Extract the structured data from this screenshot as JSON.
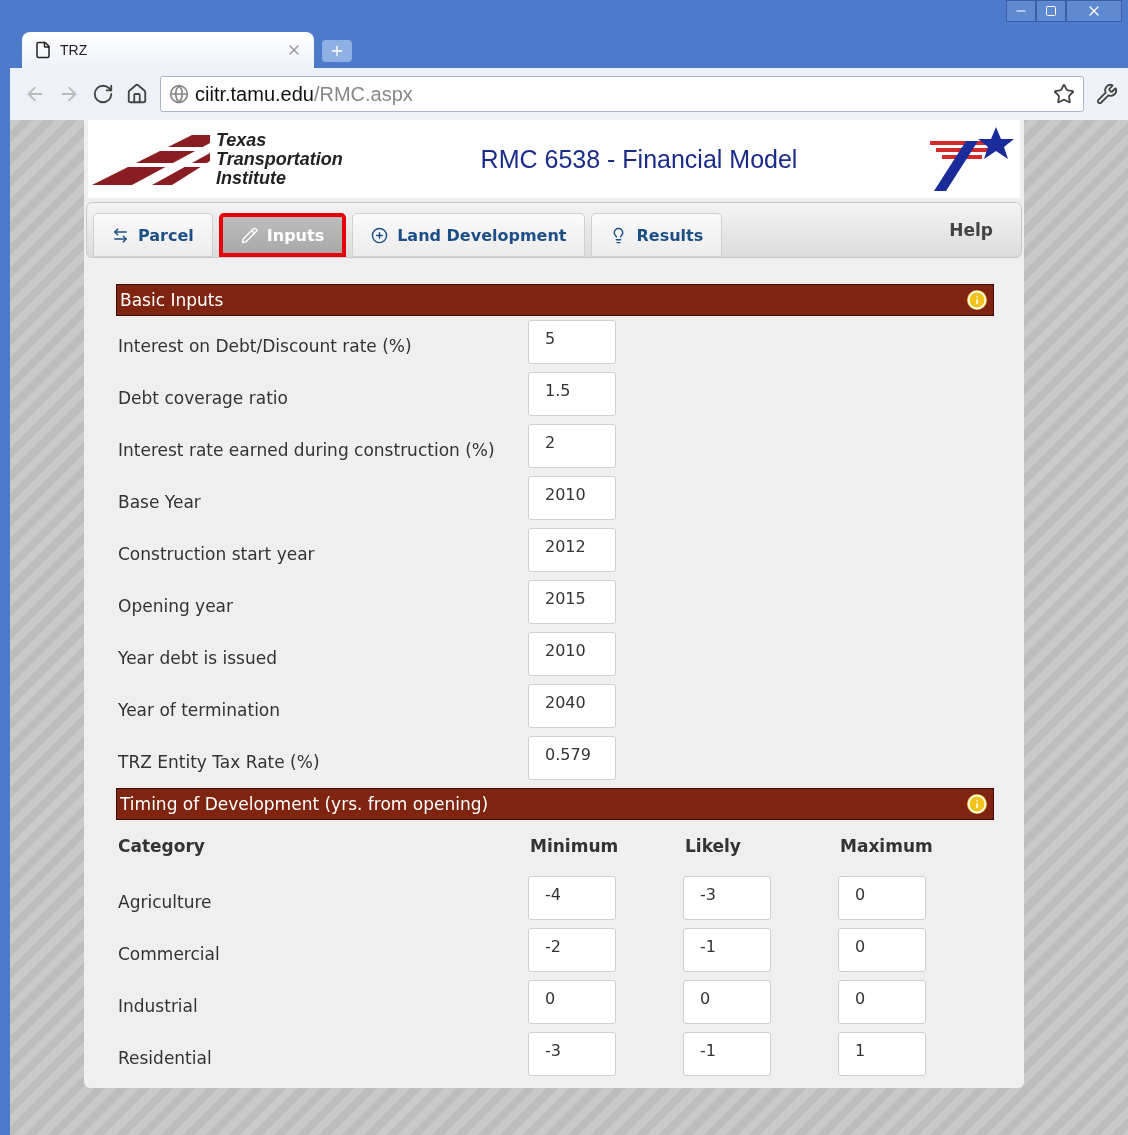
{
  "browser": {
    "tab_title": "TRZ",
    "url_host": "ciitr.tamu.edu",
    "url_path": "/RMC.aspx"
  },
  "header": {
    "logo_lines": [
      "Texas",
      "Transportation",
      "Institute"
    ],
    "title": "RMC 6538 - Financial Model"
  },
  "tabs": [
    {
      "label": "Parcel",
      "selected": false
    },
    {
      "label": "Inputs",
      "selected": true
    },
    {
      "label": "Land Development",
      "selected": false
    },
    {
      "label": "Results",
      "selected": false
    }
  ],
  "help": "Help",
  "basic_inputs": {
    "title": "Basic Inputs",
    "fields": [
      {
        "label": "Interest on Debt/Discount rate (%)",
        "value": "5"
      },
      {
        "label": "Debt coverage ratio",
        "value": "1.5"
      },
      {
        "label": "Interest rate earned during construction (%)",
        "value": "2"
      },
      {
        "label": "Base Year",
        "value": "2010"
      },
      {
        "label": "Construction start year",
        "value": "2012"
      },
      {
        "label": "Opening year",
        "value": "2015"
      },
      {
        "label": "Year debt is issued",
        "value": "2010"
      },
      {
        "label": "Year of termination",
        "value": "2040"
      },
      {
        "label": "TRZ Entity Tax Rate (%)",
        "value": "0.579"
      }
    ]
  },
  "timing": {
    "title": "Timing of Development (yrs. from opening)",
    "columns": [
      "Category",
      "Minimum",
      "Likely",
      "Maximum"
    ],
    "rows": [
      {
        "category": "Agriculture",
        "values": [
          "-4",
          "-3",
          "0"
        ]
      },
      {
        "category": "Commercial",
        "values": [
          "-2",
          "-1",
          "0"
        ]
      },
      {
        "category": "Industrial",
        "values": [
          "0",
          "0",
          "0"
        ]
      },
      {
        "category": "Residential",
        "values": [
          "-3",
          "-1",
          "1"
        ]
      }
    ]
  }
}
